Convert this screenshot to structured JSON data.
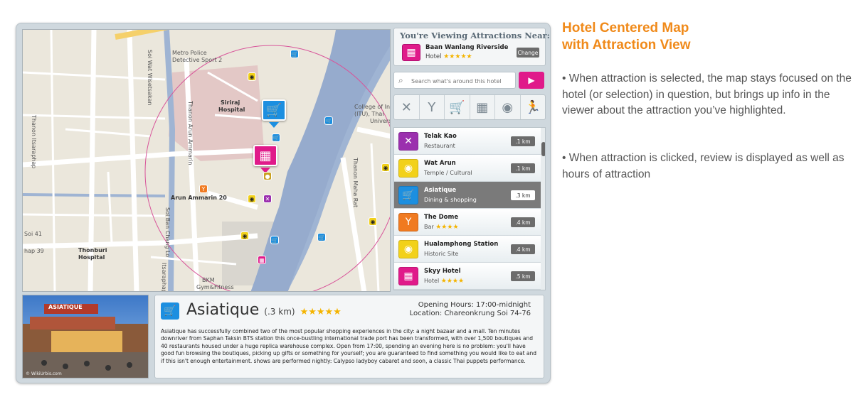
{
  "annotation": {
    "title_line1": "Hotel Centered Map",
    "title_line2": "with Attraction View",
    "bullet1": "• When attraction is selected, the map stays focused on the hotel (or selection) in question, but brings up info in the viewer about the attraction you’ve highlighted.",
    "bullet2": "• When attraction is clicked, review is displayed as well as hours of attraction"
  },
  "map": {
    "labels": {
      "metro_police_1": "Metro Police",
      "metro_police_2": "Detective Sport 2",
      "siriraj_1": "Siriraj",
      "siriraj_2": "Hospital",
      "college_1": "College of In",
      "college_2": "(ITU), Thai",
      "college_3": "Univers",
      "arun_amarin": "Arun Ammarin 20",
      "arun_amarin_v": "Thanon Arun Ammarin",
      "thonburi_1": "Thonburi",
      "thonburi_2": "Hospital",
      "soi_wisetsak": "Soi Wat Wisetsakan",
      "thanon_issaraphap": "Thanon Itsaraphap",
      "soi_bang_chang": "Soi Ban Chang Lo",
      "itsaraphap_44": "Itsaraphap 44",
      "thanon_maha_rat": "Thanon Maha Rat",
      "soi_41": "Soi 41",
      "map_39": "hap 39",
      "gym": "Gym&Fitness",
      "bkm": "BKM"
    }
  },
  "viewing": {
    "title": "You're Viewing Attractions Near:",
    "hotel_name": "Baan Wanlang Riverside",
    "hotel_type": "Hotel",
    "hotel_stars": "★★★★★",
    "change_label": "Change",
    "icon": "hotel-icon"
  },
  "search": {
    "placeholder": "Search what's around this hotel",
    "go_label": "▶"
  },
  "filters": [
    {
      "name": "restaurant",
      "glyph": "✕"
    },
    {
      "name": "bar",
      "glyph": "Y"
    },
    {
      "name": "shopping",
      "glyph": "🛒"
    },
    {
      "name": "hotel",
      "glyph": "▦"
    },
    {
      "name": "camera",
      "glyph": "◉"
    },
    {
      "name": "sport",
      "glyph": "🏃"
    }
  ],
  "attractions": [
    {
      "name": "Telak Kao",
      "type": "Restaurant",
      "stars": "",
      "distance": ".1 km",
      "color": "#9b2fae",
      "glyph": "✕",
      "icon": "restaurant-icon"
    },
    {
      "name": "Wat Arun",
      "type": "Temple / Cultural",
      "stars": "",
      "distance": ".1 km",
      "color": "#f2d11a",
      "glyph": "◉",
      "icon": "camera-icon"
    },
    {
      "name": "Asiatique",
      "type": "Dining & shopping",
      "stars": "",
      "distance": ".3 km",
      "color": "#1c8fe0",
      "glyph": "🛒",
      "icon": "shopping-icon"
    },
    {
      "name": "The Dome",
      "type": "Bar",
      "stars": "★★★★",
      "distance": ".4 km",
      "color": "#f07a20",
      "glyph": "Y",
      "icon": "bar-icon"
    },
    {
      "name": "Hualamphong Station",
      "type": "Historic Site",
      "stars": "",
      "distance": ".4 km",
      "color": "#f2d11a",
      "glyph": "◉",
      "icon": "camera-icon"
    },
    {
      "name": "Skyy Hotel",
      "type": "Hotel",
      "stars": "★★★★",
      "distance": ".5 km",
      "color": "#e01a8a",
      "glyph": "▦",
      "icon": "hotel-icon"
    }
  ],
  "detail": {
    "name": "Asiatique",
    "distance": "(.3 km)",
    "stars": "★★★★★",
    "hours": "Opening Hours: 17:00-midnight",
    "location": "Location: Chareonkrung Soi 74-76",
    "description": "Asiatique has successfully combined two of the most popular shopping experiences in the city: a night bazaar and a mall. Ten minutes downriver from Saphan Taksin BTS station this once-bustling international trade port has been transformed, with over 1,500 boutiques and 40 restaurants housed under a huge replica warehouse complex. Open from 17:00, spending an evening here is no problem: you'll have good fun browsing the boutiques, picking up gifts or something for yourself; you are guaranteed to find something you would like to eat and if this isn't enough entertainment. shows are performed nightly: Calypso ladyboy cabaret and soon, a classic Thai puppets performance.",
    "photo_sign": "ASIATIQUE",
    "photo_credit": "© WikiUrbis.com"
  }
}
